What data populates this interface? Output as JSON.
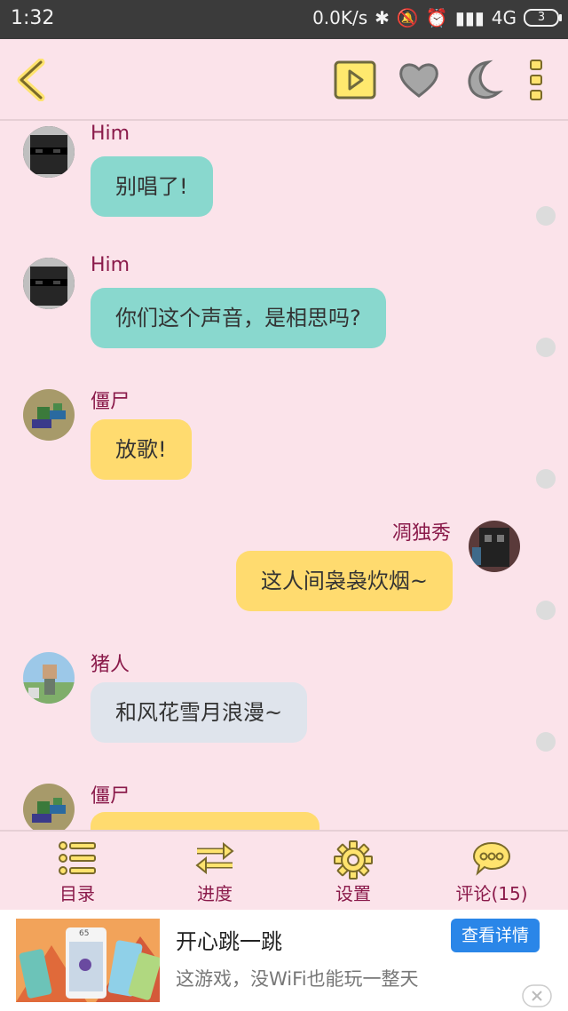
{
  "status": {
    "time": "1:32",
    "net_speed": "0.0K/s",
    "network": "4G",
    "battery": "3"
  },
  "messages": [
    {
      "name": "Him",
      "text": "别唱了!",
      "side": "left",
      "color": "teal",
      "avatar": "sunglasses-avatar"
    },
    {
      "name": "Him",
      "text": "你们这个声音，是相思吗?",
      "side": "left",
      "color": "teal",
      "avatar": "sunglasses-avatar"
    },
    {
      "name": "僵尸",
      "text": "放歌!",
      "side": "left",
      "color": "yellow",
      "avatar": "zombie-avatar"
    },
    {
      "name": "凋独秀",
      "text": "这人间袅袅炊烟~",
      "side": "right",
      "color": "yellow",
      "avatar": "wither-avatar"
    },
    {
      "name": "猪人",
      "text": "和风花雪月浪漫~",
      "side": "left",
      "color": "grey",
      "avatar": "pigman-avatar"
    },
    {
      "name": "僵尸",
      "text": "",
      "side": "left",
      "color": "yellow",
      "avatar": "zombie-avatar"
    }
  ],
  "nav": {
    "catalog": "目录",
    "progress": "进度",
    "settings": "设置",
    "comments": "评论(15)"
  },
  "ad": {
    "title": "开心跳一跳",
    "description": "这游戏，没WiFi也能玩一整天",
    "button": "查看详情",
    "thumb_number": "65"
  },
  "colors": {
    "background": "#fbe3ea",
    "name_text": "#8a1a4a",
    "bubble_teal": "#89d8ce",
    "bubble_yellow": "#ffdb6f",
    "bubble_grey": "#dfe4ec",
    "ad_button": "#2a86e8"
  }
}
